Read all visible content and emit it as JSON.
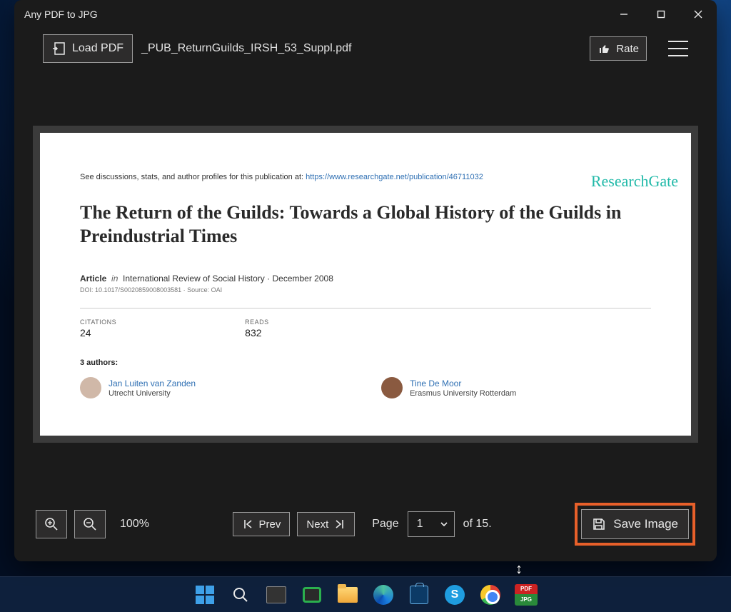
{
  "window": {
    "title": "Any PDF to JPG",
    "filename": "_PUB_ReturnGuilds_IRSH_53_Suppl.pdf"
  },
  "toolbar": {
    "load_label": "Load PDF",
    "rate_label": "Rate"
  },
  "preview": {
    "researchgate_label": "ResearchGate",
    "discussion_prefix": "See discussions, stats, and author profiles for this publication at: ",
    "discussion_link": "https://www.researchgate.net/publication/46711032",
    "paper_title": "The Return of the Guilds: Towards a Global History of the Guilds in Preindustrial Times",
    "article_label": "Article",
    "in_label": "in",
    "journal": "International Review of Social History",
    "pub_date": "December 2008",
    "doi_line": "DOI: 10.1017/S0020859008003581 · Source: OAI",
    "citations_label": "CITATIONS",
    "citations_value": "24",
    "reads_label": "READS",
    "reads_value": "832",
    "authors_count_label": "3 authors:",
    "authors": [
      {
        "name": "Jan Luiten van Zanden",
        "affiliation": "Utrecht University"
      },
      {
        "name": "Tine De Moor",
        "affiliation": "Erasmus University Rotterdam"
      }
    ]
  },
  "footer": {
    "zoom_label": "100%",
    "prev_label": "Prev",
    "next_label": "Next",
    "page_label": "Page",
    "page_current": "1",
    "page_total": "of 15.",
    "save_label": "Save Image"
  },
  "taskbar": {
    "skype_letter": "S",
    "pdf_label": "PDF",
    "jpg_label": "JPG"
  }
}
